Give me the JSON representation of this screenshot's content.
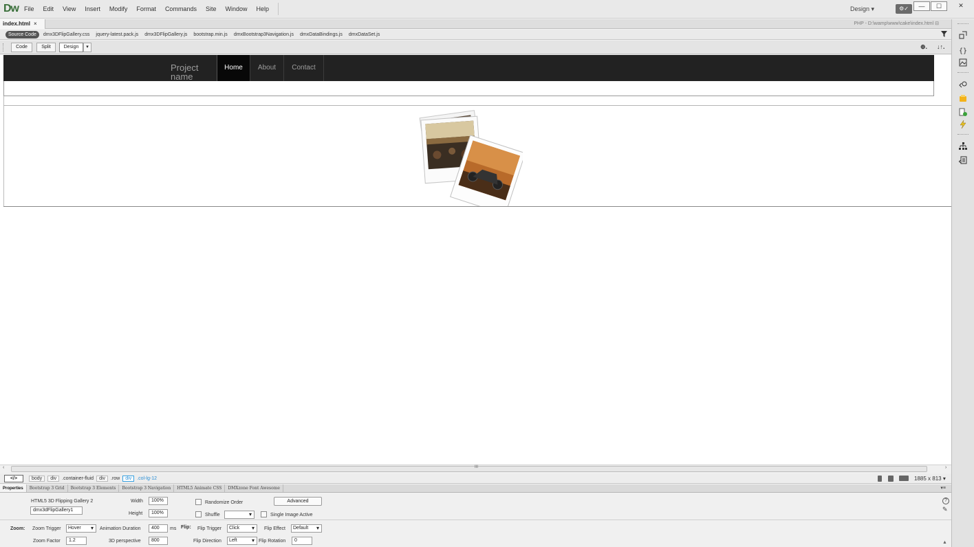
{
  "menubar": {
    "logo_dw": "Dw",
    "items": [
      "File",
      "Edit",
      "View",
      "Insert",
      "Modify",
      "Format",
      "Commands",
      "Site",
      "Window",
      "Help"
    ],
    "workspace": "Design ▾",
    "sync_label": "⚙✓",
    "win_min": "—",
    "win_max": "☐",
    "win_close": "✕"
  },
  "doc": {
    "tab_label": "index.html",
    "tab_close": "×",
    "path": "PHP - D:\\wamp\\www\\cake\\index.html",
    "path_icon": "⊟"
  },
  "related_files": {
    "source_code": "Source Code",
    "files": [
      "dmx3DFlipGallery.css",
      "jquery-latest.pack.js",
      "dmx3DFlipGallery.js",
      "bootstrap.min.js",
      "dmxBootstrap3Navigation.js",
      "dmxDataBindings.js",
      "dmxDataSet.js"
    ]
  },
  "viewbar": {
    "code": "Code",
    "split": "Split",
    "design": "Design",
    "dropdown": "▾",
    "live_icon": "⊕.",
    "sort_icon": "↓↑."
  },
  "page": {
    "brand": "Project name",
    "nav": [
      "Home",
      "About",
      "Contact"
    ]
  },
  "hscroll": {
    "left": "‹",
    "right": "›",
    "grip": "III"
  },
  "status": {
    "tag_icon": "</>",
    "crumbs": [
      "body",
      "div",
      ".container-fluid",
      "div",
      ".row"
    ],
    "selected_tag": "div",
    "selected_class": ".col-lg-12",
    "dimensions": "1885 x 813 ▾"
  },
  "props_tabs": [
    "Properties",
    "Bootstrap 3 Grid",
    "Bootstrap 3 Elements",
    "Bootstrap 3 Navigation",
    "HTML5 Animate CSS",
    "DMXzone Font Awesome"
  ],
  "props": {
    "component": "HTML5 3D Flipping Gallery 2",
    "id_value": "dmx3dFlipGallery1",
    "width_label": "Width",
    "width_value": "100%",
    "height_label": "Height",
    "height_value": "100%",
    "randomize": "Randomize Order",
    "shuffle": "Shuffle",
    "shuffle_value": "",
    "single_image": "Single Image Active",
    "advanced": "Advanced",
    "zoom_label": "Zoom:",
    "zoom_trigger_label": "Zoom Trigger",
    "zoom_trigger_value": "Hover",
    "anim_duration_label": "Animation Duration",
    "anim_duration_value": "400",
    "ms": "ms",
    "flip_label": "Flip:",
    "flip_trigger_label": "Flip Trigger",
    "flip_trigger_value": "Click",
    "flip_effect_label": "Flip Effect",
    "flip_effect_value": "Default",
    "zoom_factor_label": "Zoom Factor",
    "zoom_factor_value": "1.2",
    "perspective_label": "3D perspective",
    "perspective_value": "800",
    "flip_direction_label": "Flip Direction",
    "flip_direction_value": "Left",
    "flip_rotation_label": "Flip Rotation",
    "flip_rotation_value": "0",
    "help_icon": "?",
    "edit_icon": "✎",
    "options_icon": "▾≡",
    "collapse_icon": "▲"
  },
  "colors": {
    "navbar_bg": "#222222",
    "nav_active_bg": "#080808",
    "nav_text": "#9d9d9d",
    "selection_blue": "#2a8fd6"
  }
}
